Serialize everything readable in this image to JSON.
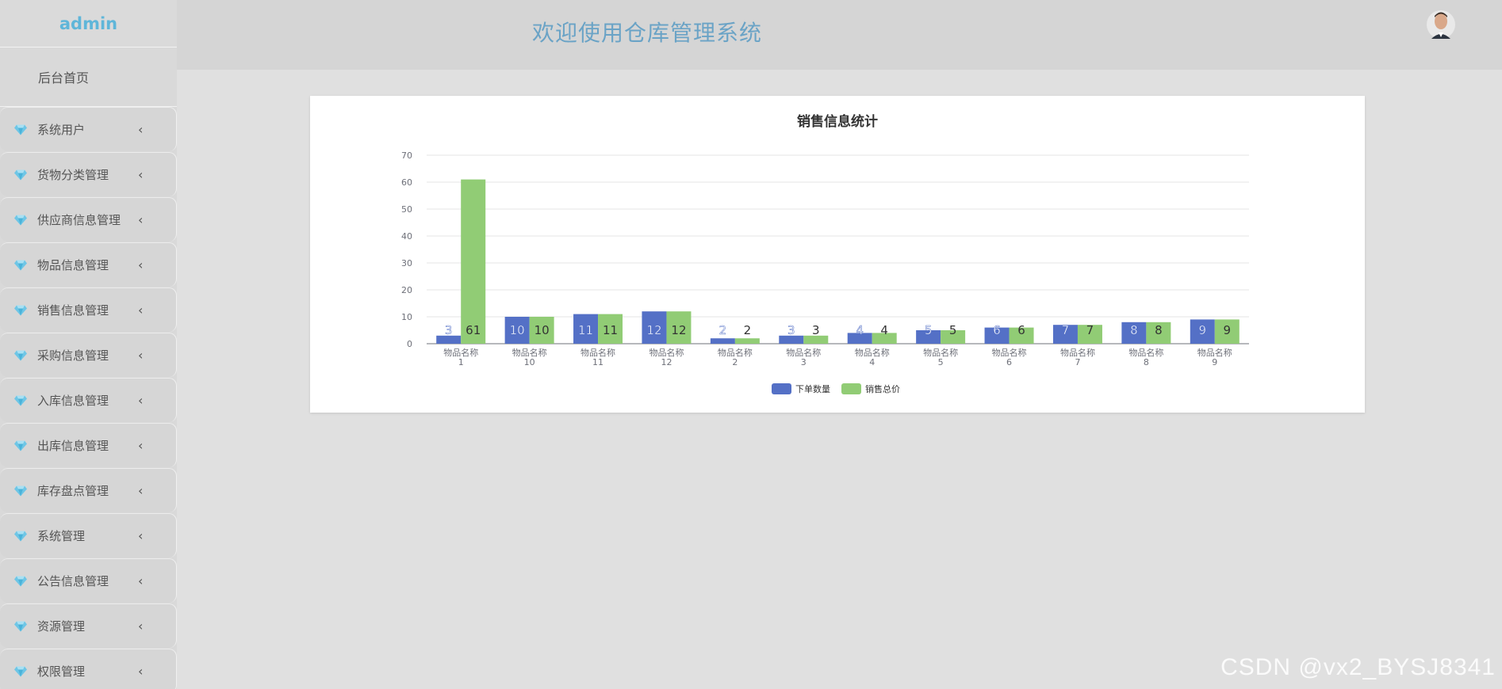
{
  "sidebar": {
    "brand": "admin",
    "home": "后台首页",
    "items": [
      {
        "label": "系统用户",
        "icon": "diamond-icon"
      },
      {
        "label": "货物分类管理",
        "icon": "diamond-icon"
      },
      {
        "label": "供应商信息管理",
        "icon": "diamond-icon"
      },
      {
        "label": "物品信息管理",
        "icon": "diamond-icon"
      },
      {
        "label": "销售信息管理",
        "icon": "diamond-icon"
      },
      {
        "label": "采购信息管理",
        "icon": "diamond-icon"
      },
      {
        "label": "入库信息管理",
        "icon": "diamond-icon"
      },
      {
        "label": "出库信息管理",
        "icon": "diamond-icon"
      },
      {
        "label": "库存盘点管理",
        "icon": "diamond-icon"
      },
      {
        "label": "系统管理",
        "icon": "diamond-icon"
      },
      {
        "label": "公告信息管理",
        "icon": "diamond-icon"
      },
      {
        "label": "资源管理",
        "icon": "diamond-icon"
      },
      {
        "label": "权限管理",
        "icon": "diamond-icon"
      }
    ],
    "chevron": "‹"
  },
  "header": {
    "title": "欢迎使用仓库管理系统",
    "avatar_icon": "user-avatar-icon"
  },
  "watermark": "CSDN @vx2_BYSJ8341",
  "colors": {
    "series1": "#5470c6",
    "series2": "#91cc75",
    "title_blue": "#6aa3c6",
    "brand": "#5fb6d9"
  },
  "chart_data": {
    "type": "bar",
    "title": "销售信息统计",
    "categories": [
      "物品名称\n1",
      "物品名称\n10",
      "物品名称\n11",
      "物品名称\n12",
      "物品名称\n2",
      "物品名称\n3",
      "物品名称\n4",
      "物品名称\n5",
      "物品名称\n6",
      "物品名称\n7",
      "物品名称\n8",
      "物品名称\n9"
    ],
    "series": [
      {
        "name": "下单数量",
        "values": [
          3,
          10,
          11,
          12,
          2,
          3,
          4,
          5,
          6,
          7,
          8,
          9
        ],
        "color": "#5470c6"
      },
      {
        "name": "销售总价",
        "values": [
          61,
          10,
          11,
          12,
          2,
          3,
          4,
          5,
          6,
          7,
          8,
          9
        ],
        "color": "#91cc75"
      }
    ],
    "yticks": [
      0,
      10,
      20,
      30,
      40,
      50,
      60,
      70
    ],
    "ylim": [
      0,
      70
    ],
    "grid": true,
    "legend": "bottom-center"
  }
}
